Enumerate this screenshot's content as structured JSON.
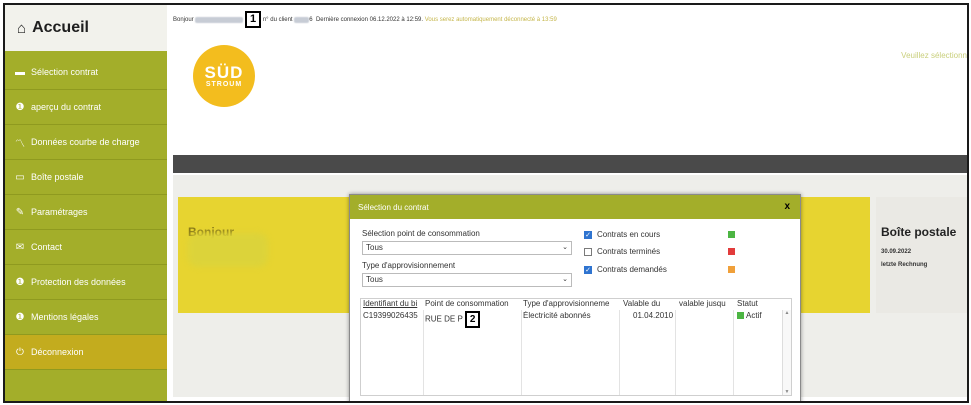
{
  "sidebar": {
    "brand": "Accueil",
    "items": [
      {
        "label": "Sélection contrat",
        "icon": "folder-icon",
        "glyph": "▬"
      },
      {
        "label": "aperçu du contrat",
        "icon": "info-icon",
        "glyph": "❶"
      },
      {
        "label": "Données courbe de charge",
        "icon": "line-chart-icon",
        "glyph": "〽"
      },
      {
        "label": "Boîte postale",
        "icon": "inbox-icon",
        "glyph": "▭"
      },
      {
        "label": "Paramétrages",
        "icon": "wrench-icon",
        "glyph": "✎"
      },
      {
        "label": "Contact",
        "icon": "envelope-icon",
        "glyph": "✉"
      },
      {
        "label": "Protection des données",
        "icon": "info-icon",
        "glyph": "❶"
      },
      {
        "label": "Mentions légales",
        "icon": "info-icon",
        "glyph": "❶"
      },
      {
        "label": "Déconnexion",
        "icon": "power-icon",
        "glyph": "⏻"
      }
    ]
  },
  "topbar": {
    "greeting": "Bonjour",
    "marker_1": "1",
    "client_label": "n° du client",
    "client_suffix": "6",
    "last_login": "Dernière connexion 06.12.2022 à 12:59.",
    "auto_logout": "Vous serez automatiquement déconnecté à 13:59"
  },
  "logo": {
    "line1": "SÜD",
    "line2": "STROUM"
  },
  "select_hint": "Veuillez sélectionn",
  "cards": {
    "left_title": "Bonjour",
    "right_title": "Boîte postale",
    "right_date": "30.09.2022",
    "right_sub": "letzte Rechnung"
  },
  "modal": {
    "title": "Sélection du contrat",
    "close": "x",
    "consumption_label": "Sélection point de consommation",
    "consumption_value": "Tous",
    "supply_label": "Type d'approvisionnement",
    "supply_value": "Tous",
    "checks": [
      {
        "label": "Contrats en cours",
        "checked": true,
        "color": "#4cb543"
      },
      {
        "label": "Contrats terminés",
        "checked": false,
        "color": "#e23b3b"
      },
      {
        "label": "Contrats demandés",
        "checked": true,
        "color": "#f0a03a"
      }
    ],
    "table": {
      "headers": [
        "Identifiant du bi",
        "Point de consommation",
        "Type d'approvisionneme",
        "Valable du",
        "valable jusqu",
        "Statut"
      ],
      "row": [
        "C19399026435",
        "RUE DE P",
        "Électricité abonnés",
        "01.04.2010",
        "",
        "Actif"
      ],
      "marker_2": "2"
    }
  },
  "colors": {
    "sidebar": "#a3ae2a",
    "active": "#c3ac1e",
    "logo": "#f3bd1e",
    "card": "#e7d430"
  }
}
